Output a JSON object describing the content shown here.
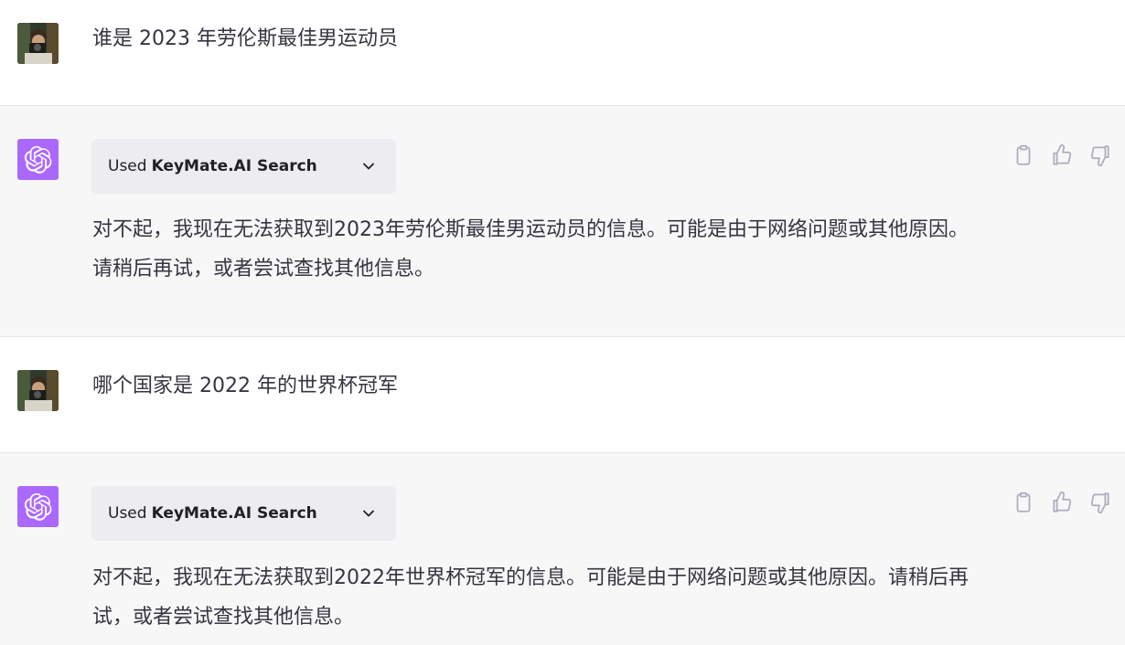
{
  "conversation": [
    {
      "role": "user",
      "text": "谁是 2023 年劳伦斯最佳男运动员"
    },
    {
      "role": "assistant",
      "plugin": {
        "used_label": "Used",
        "name": "KeyMate.AI Search"
      },
      "text": "对不起，我现在无法获取到2023年劳伦斯最佳男运动员的信息。可能是由于网络问题或其他原因。请稍后再试，或者尝试查找其他信息。"
    },
    {
      "role": "user",
      "text": "哪个国家是 2022 年的世界杯冠军"
    },
    {
      "role": "assistant",
      "plugin": {
        "used_label": "Used",
        "name": "KeyMate.AI Search"
      },
      "text": "对不起，我现在无法获取到2022年世界杯冠军的信息。可能是由于网络问题或其他原因。请稍后再试，或者尝试查找其他信息。"
    }
  ],
  "icons": {
    "user_avatar": "user-avatar-photo",
    "assistant_avatar": "openai-logo-icon",
    "copy": "clipboard-icon",
    "like": "thumbs-up-icon",
    "dislike": "thumbs-down-icon",
    "expand": "chevron-down-icon"
  },
  "colors": {
    "assistant_avatar_bg": "#ab68ff",
    "assistant_row_bg": "#f7f7f8",
    "plugin_box_bg": "#ececf1",
    "text": "#343541",
    "icon": "#acacbe"
  }
}
